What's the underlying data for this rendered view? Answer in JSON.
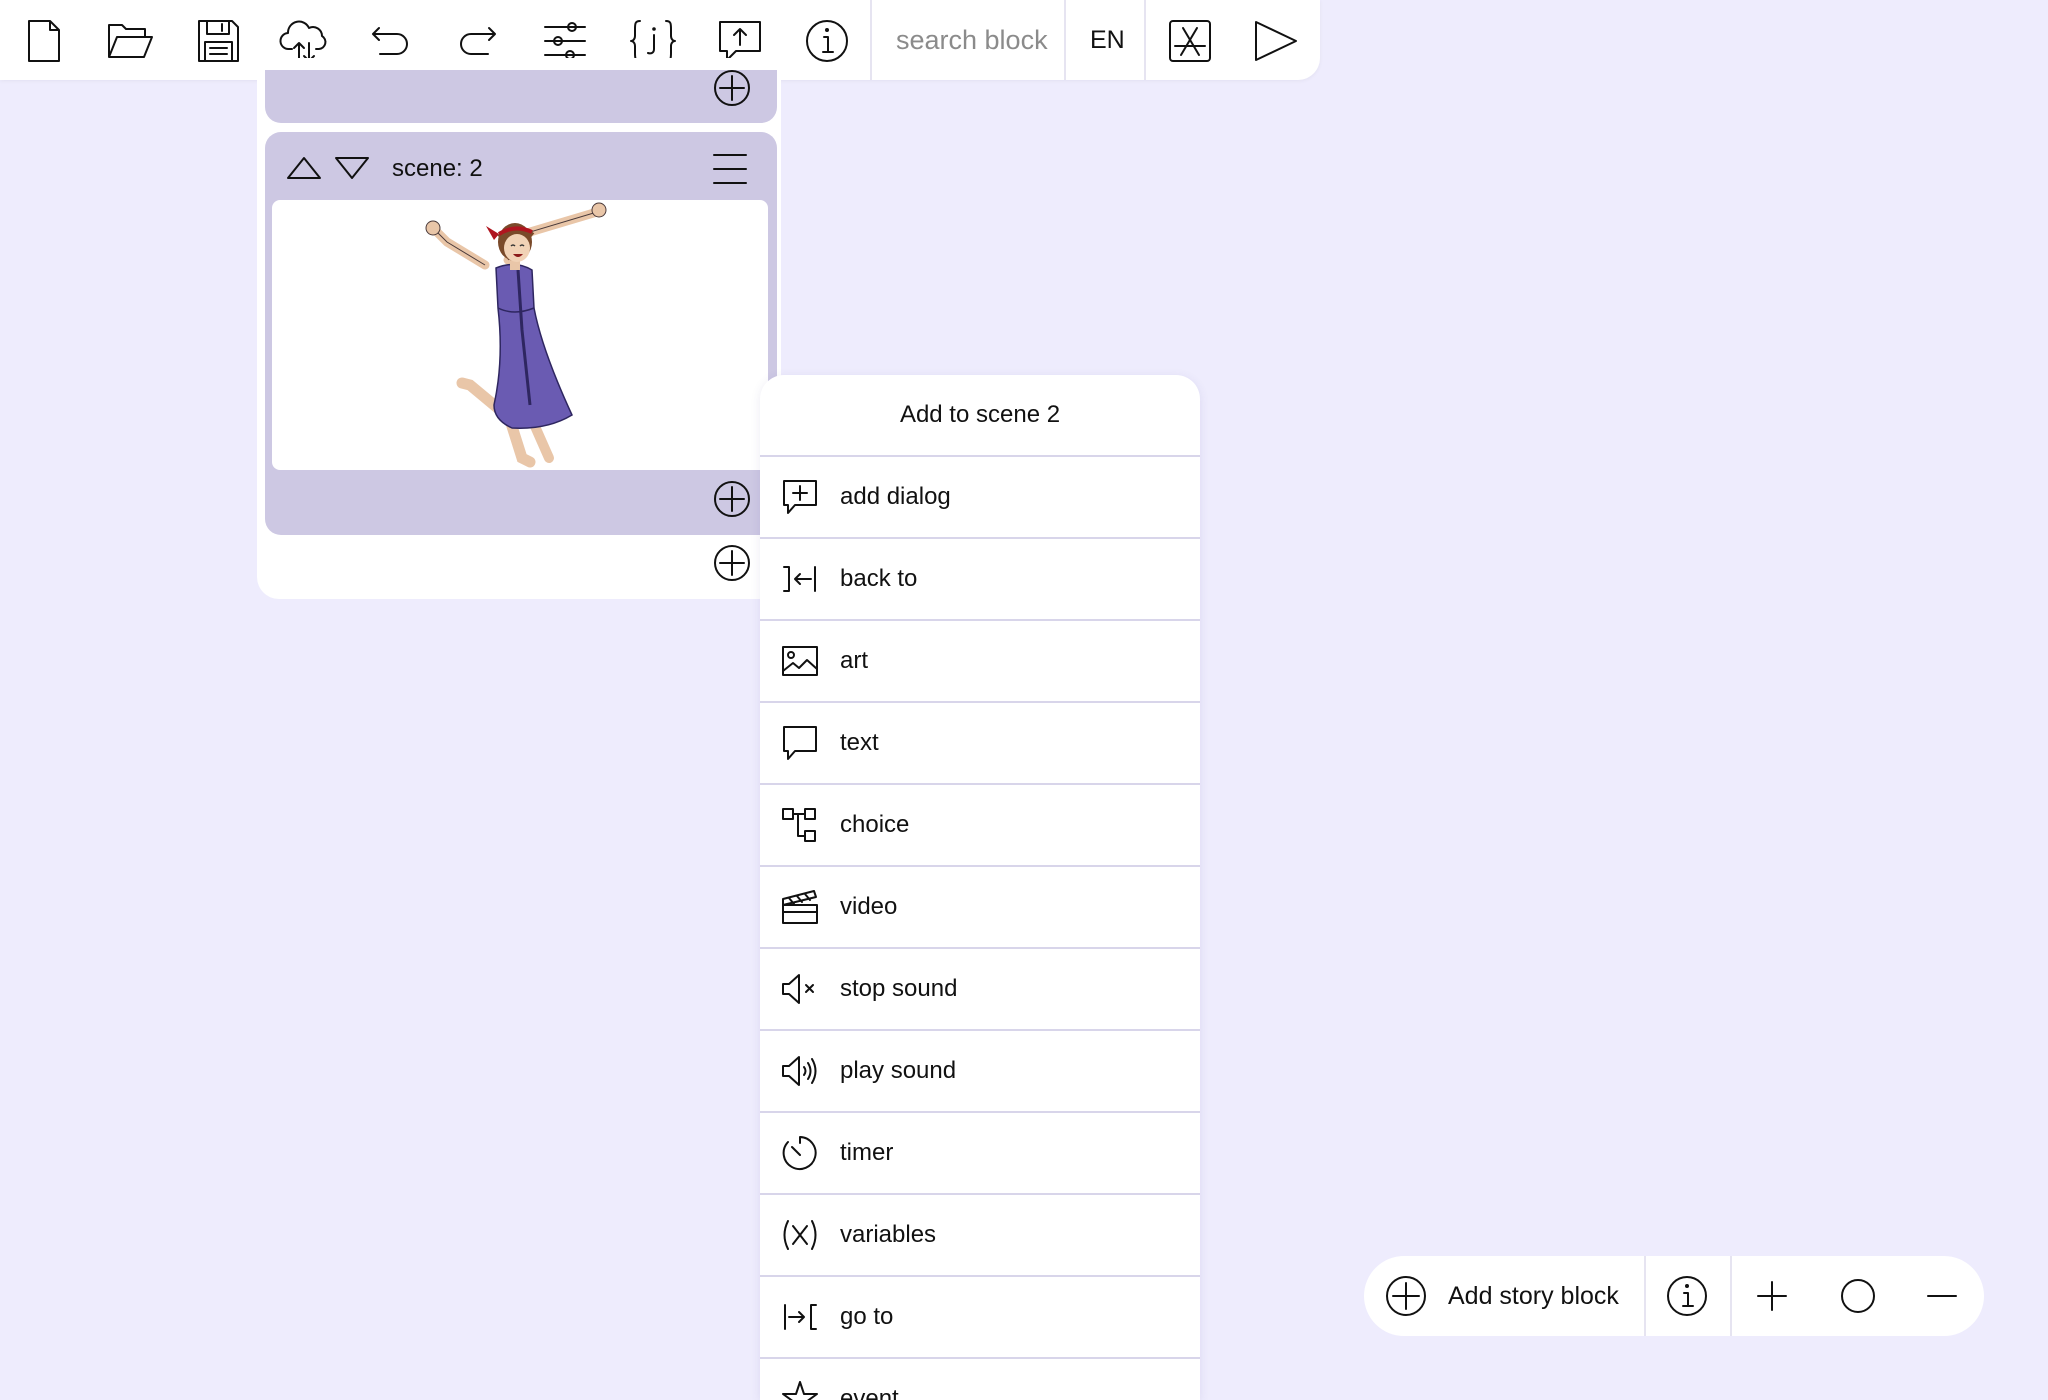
{
  "toolbar": {
    "buttons": [
      {
        "name": "new-file",
        "icon": "file-icon"
      },
      {
        "name": "open-folder",
        "icon": "folder-open-icon"
      },
      {
        "name": "save",
        "icon": "floppy-disk-icon"
      },
      {
        "name": "cloud-sync",
        "icon": "cloud-sync-icon"
      },
      {
        "name": "undo",
        "icon": "undo-icon"
      },
      {
        "name": "redo",
        "icon": "redo-icon"
      },
      {
        "name": "settings",
        "icon": "sliders-icon"
      },
      {
        "name": "json",
        "icon": "json-braces-icon"
      },
      {
        "name": "publish",
        "icon": "speech-upload-icon"
      },
      {
        "name": "info",
        "icon": "info-icon"
      }
    ],
    "search_placeholder": "search block",
    "language": "EN",
    "extra_buttons": [
      {
        "name": "app-store",
        "icon": "app-store-icon"
      },
      {
        "name": "play",
        "icon": "play-icon"
      }
    ]
  },
  "scene": {
    "title": "scene: 2",
    "image_alt": "cartoon girl in purple dress jumping with arms raised"
  },
  "popup": {
    "title": "Add to scene 2",
    "items": [
      {
        "label": "add dialog",
        "icon": "dialog-add-icon"
      },
      {
        "label": "back to",
        "icon": "back-to-icon"
      },
      {
        "label": "art",
        "icon": "image-icon"
      },
      {
        "label": "text",
        "icon": "speech-bubble-icon"
      },
      {
        "label": "choice",
        "icon": "choice-tree-icon"
      },
      {
        "label": "video",
        "icon": "clapperboard-icon"
      },
      {
        "label": "stop sound",
        "icon": "speaker-mute-icon"
      },
      {
        "label": "play sound",
        "icon": "speaker-play-icon"
      },
      {
        "label": "timer",
        "icon": "timer-icon"
      },
      {
        "label": "variables",
        "icon": "variables-icon"
      },
      {
        "label": "go to",
        "icon": "go-to-icon"
      },
      {
        "label": "event",
        "icon": "event-star-icon"
      }
    ]
  },
  "bottombar": {
    "add_story_block": "Add story block",
    "buttons": [
      {
        "name": "info",
        "icon": "info-icon"
      },
      {
        "name": "zoom-in",
        "icon": "plus-icon"
      },
      {
        "name": "reset-zoom",
        "icon": "circle-icon"
      },
      {
        "name": "zoom-out",
        "icon": "minus-icon"
      }
    ]
  },
  "colors": {
    "background": "#eeecfd",
    "panel": "#ffffff",
    "scene_card": "#cdc8e3",
    "divider": "#d8d5ea"
  }
}
